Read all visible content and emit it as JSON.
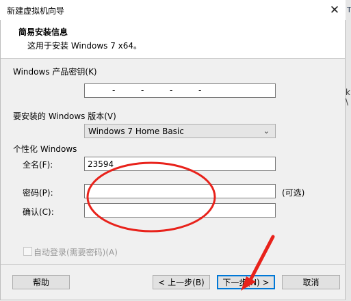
{
  "window": {
    "title": "新建虚拟机向导",
    "close_glyph": "✕"
  },
  "header": {
    "title": "简易安装信息",
    "subtitle": "这用于安装 Windows 7 x64。"
  },
  "fields": {
    "product_key_label": "Windows 产品密钥(K)",
    "product_key_value": "",
    "product_key_dashes": [
      "-",
      "-",
      "-",
      "-"
    ],
    "edition_label": "要安装的 Windows 版本(V)",
    "edition_selected": "Windows 7 Home Basic",
    "personalize_label": "个性化 Windows",
    "fullname_label": "全名(F):",
    "fullname_value": "23594",
    "password_label": "密码(P):",
    "password_value": "",
    "password_optional": "(可选)",
    "confirm_label": "确认(C):",
    "confirm_value": "",
    "autologin_label": "自动登录(需要密码)(A)"
  },
  "buttons": {
    "help": "帮助",
    "back": "< 上一步(B)",
    "next": "下一步(N) >",
    "cancel": "取消"
  },
  "background_fragments": {
    "strip_t": "T",
    "frag1": "k",
    "frag2": "\\"
  },
  "annotations": {
    "ellipse_color": "#e8221b",
    "arrow_color": "#e8221b"
  }
}
